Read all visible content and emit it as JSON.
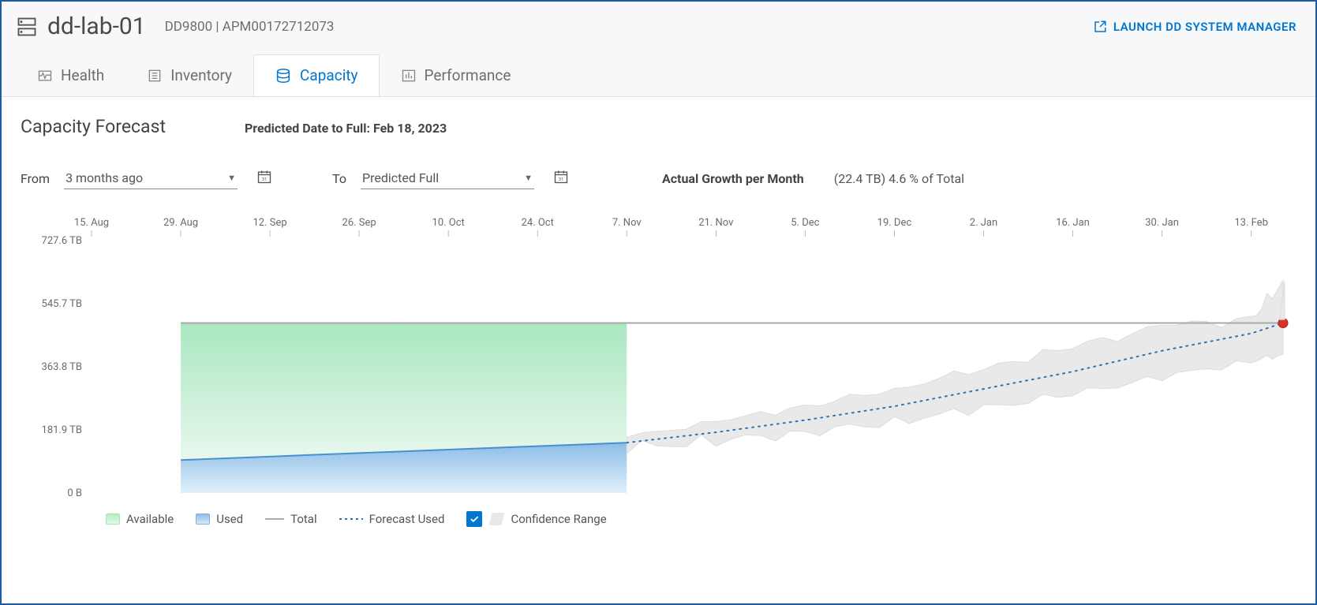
{
  "header": {
    "hostname": "dd-lab-01",
    "model": "DD9800",
    "serial": "APM00172712073",
    "launch_label": "LAUNCH DD SYSTEM MANAGER"
  },
  "tabs": {
    "health": "Health",
    "inventory": "Inventory",
    "capacity": "Capacity",
    "performance": "Performance"
  },
  "page": {
    "title": "Capacity Forecast",
    "predicted_label": "Predicted Date to Full: Feb 18, 2023"
  },
  "controls": {
    "from_label": "From",
    "from_value": "3 months ago",
    "to_label": "To",
    "to_value": "Predicted Full",
    "growth_label": "Actual Growth per Month",
    "growth_value": "(22.4 TB) 4.6 % of Total"
  },
  "legend": {
    "available": "Available",
    "used": "Used",
    "total": "Total",
    "forecast": "Forecast Used",
    "confidence": "Confidence Range"
  },
  "chart_data": {
    "type": "area",
    "title": "Capacity Forecast",
    "xlabel": "",
    "ylabel": "",
    "ylim": [
      0,
      727.6
    ],
    "y_ticks": [
      {
        "v": 0,
        "label": "0 B"
      },
      {
        "v": 181.9,
        "label": "181.9 TB"
      },
      {
        "v": 363.8,
        "label": "363.8 TB"
      },
      {
        "v": 545.7,
        "label": "545.7 TB"
      },
      {
        "v": 727.6,
        "label": "727.6 TB"
      }
    ],
    "x_ticks": [
      "15. Aug",
      "29. Aug",
      "12. Sep",
      "26. Sep",
      "10. Oct",
      "24. Oct",
      "7. Nov",
      "21. Nov",
      "5. Dec",
      "19. Dec",
      "2. Jan",
      "16. Jan",
      "30. Jan",
      "13. Feb"
    ],
    "total_capacity_tb": 490,
    "actual_x_range": [
      "29. Aug",
      "7. Nov"
    ],
    "used_tb_actual": [
      {
        "x": "29. Aug",
        "v": 95
      },
      {
        "x": "12. Sep",
        "v": 105
      },
      {
        "x": "26. Sep",
        "v": 115
      },
      {
        "x": "10. Oct",
        "v": 125
      },
      {
        "x": "24. Oct",
        "v": 135
      },
      {
        "x": "7. Nov",
        "v": 145
      }
    ],
    "forecast_used_tb": [
      {
        "x": "7. Nov",
        "v": 145
      },
      {
        "x": "21. Nov",
        "v": 175
      },
      {
        "x": "5. Dec",
        "v": 210
      },
      {
        "x": "19. Dec",
        "v": 250
      },
      {
        "x": "2. Jan",
        "v": 300
      },
      {
        "x": "16. Jan",
        "v": 350
      },
      {
        "x": "30. Jan",
        "v": 410
      },
      {
        "x": "13. Feb",
        "v": 460
      },
      {
        "x": "18. Feb",
        "v": 490
      }
    ],
    "confidence_band_tb": [
      {
        "x": "7. Nov",
        "lo": 130,
        "hi": 160
      },
      {
        "x": "21. Nov",
        "lo": 150,
        "hi": 205
      },
      {
        "x": "5. Dec",
        "lo": 175,
        "hi": 250
      },
      {
        "x": "19. Dec",
        "lo": 205,
        "hi": 300
      },
      {
        "x": "2. Jan",
        "lo": 245,
        "hi": 360
      },
      {
        "x": "16. Jan",
        "lo": 285,
        "hi": 420
      },
      {
        "x": "30. Jan",
        "lo": 335,
        "hi": 480
      },
      {
        "x": "13. Feb",
        "lo": 380,
        "hi": 500
      },
      {
        "x": "18. Feb",
        "lo": 400,
        "hi": 610
      }
    ],
    "predicted_full_point": {
      "x": "18. Feb",
      "v": 490
    }
  }
}
